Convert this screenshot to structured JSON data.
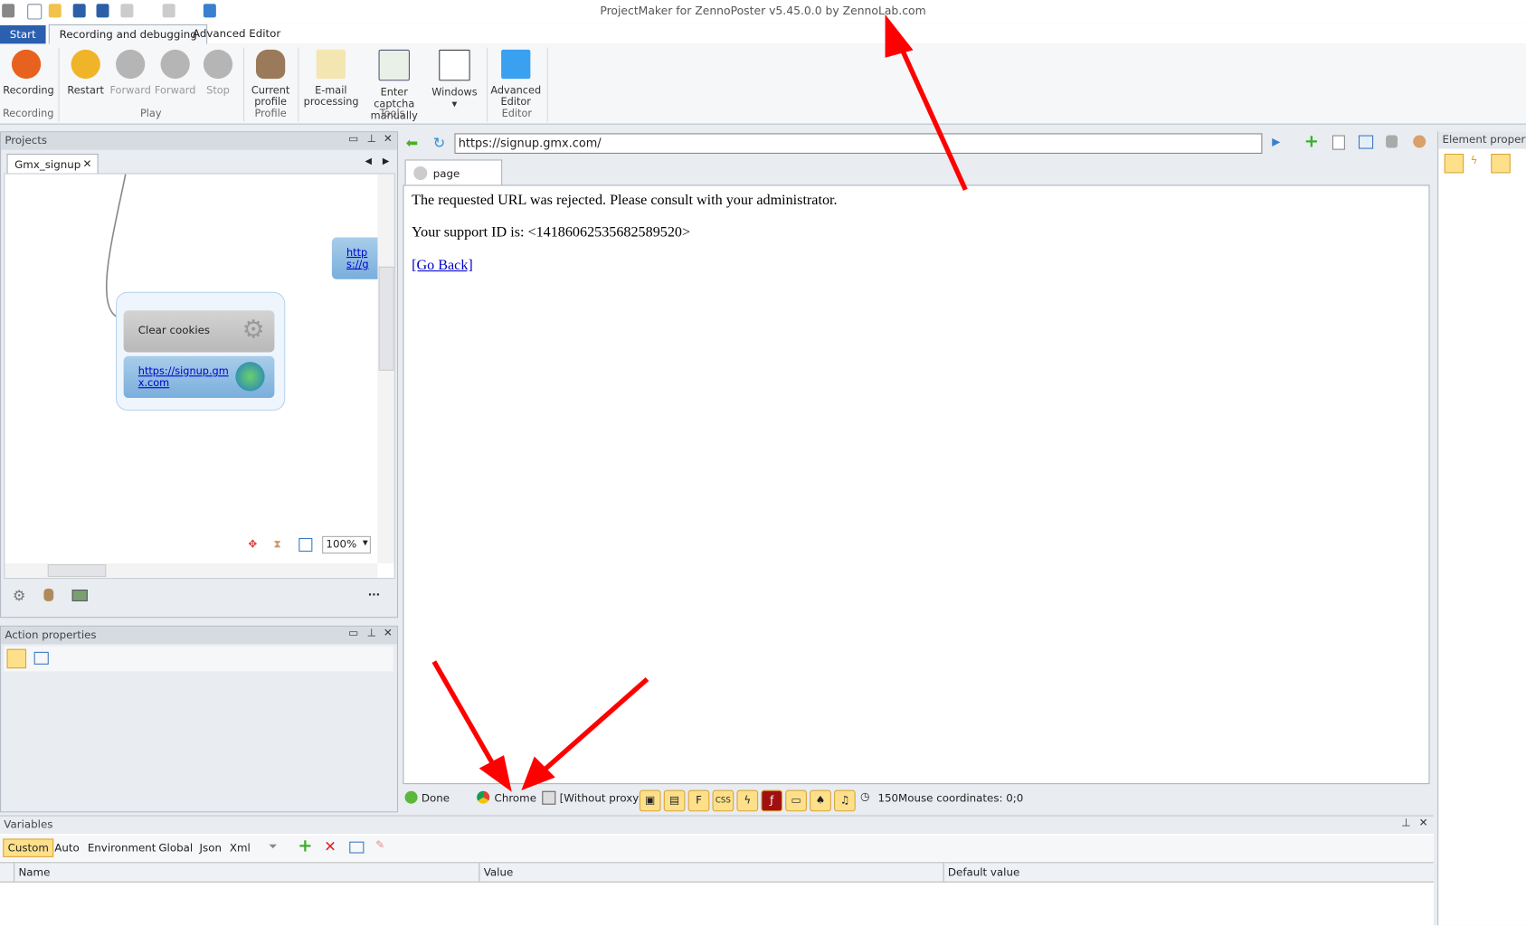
{
  "window": {
    "title": "ProjectMaker for ZennoPoster v5.45.0.0 by ZennoLab.com"
  },
  "ribbon_tabs": [
    "Start",
    "Recording and debugging",
    "Advanced Editor"
  ],
  "ribbon": {
    "buttons": [
      {
        "label": "Recording",
        "group": "Recording"
      },
      {
        "label": "Restart",
        "group": "Play"
      },
      {
        "label": "Forward",
        "group": "Play"
      },
      {
        "label": "Forward",
        "group": "Play"
      },
      {
        "label": "Stop",
        "group": "Play"
      },
      {
        "label": "Current profile",
        "group": "Profile"
      },
      {
        "label": "E-mail processing",
        "group": "Tools"
      },
      {
        "label": "Enter captcha manually",
        "group": "Tools"
      },
      {
        "label": "Windows",
        "group": "Tools"
      },
      {
        "label": "Advanced Editor",
        "group": "Editor"
      }
    ],
    "groups": [
      "Recording",
      "Play",
      "Profile",
      "Tools",
      "Editor"
    ]
  },
  "projects": {
    "title": "Projects",
    "tab": "Gmx_signup",
    "nodes": {
      "clear_cookies": "Clear cookies",
      "url_node": "https://signup.gmx.com",
      "url_node_partial": "https://gmx.ne"
    },
    "zoom": "100%",
    "more": "..."
  },
  "action_properties": {
    "title": "Action properties"
  },
  "browser": {
    "url": "https://signup.gmx.com/",
    "page_tab": "page",
    "line1": "The requested URL was rejected. Please consult with your administrator.",
    "line2": "Your support ID is: <14186062535682589520>",
    "go_back": "[Go Back]"
  },
  "status": {
    "state": "Done",
    "browser": "Chrome",
    "proxy": "[Without proxy]",
    "timeout": "150",
    "mouse": "Mouse coordinates: 0;0"
  },
  "element_properties": {
    "title": "Element properties"
  },
  "variables": {
    "title": "Variables",
    "tabs": [
      "Custom",
      "Auto",
      "Environment",
      "Global",
      "Json",
      "Xml"
    ],
    "columns": [
      "Name",
      "Value",
      "Default value"
    ]
  }
}
